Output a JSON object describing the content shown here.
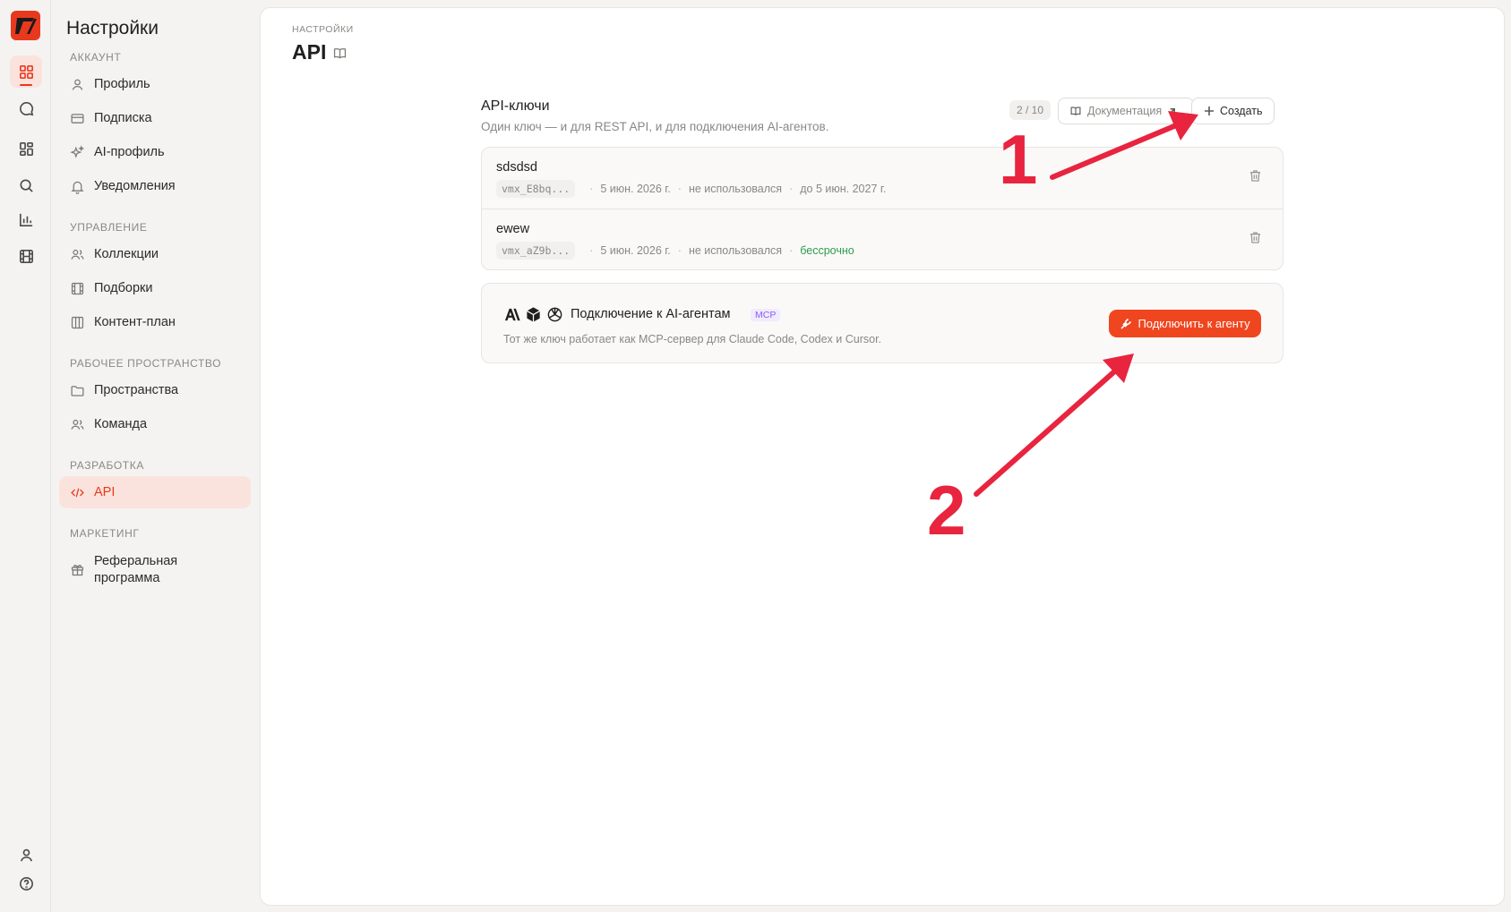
{
  "rail": {
    "items": [
      {
        "name": "dashboard",
        "active": true
      },
      {
        "name": "chat"
      },
      {
        "name": "widgets"
      },
      {
        "name": "search"
      },
      {
        "name": "analytics"
      },
      {
        "name": "film"
      }
    ],
    "bottom": [
      "user",
      "help"
    ]
  },
  "sidebar": {
    "title": "Настройки",
    "sections": {
      "account": "АККАУНТ",
      "management": "УПРАВЛЕНИЕ",
      "workspace": "РАБОЧЕЕ ПРОСТРАНСТВО",
      "development": "РАЗРАБОТКА",
      "marketing": "МАРКЕТИНГ"
    },
    "items": {
      "profile": "Профиль",
      "subscription": "Подписка",
      "ai_profile": "AI-профиль",
      "notifications": "Уведомления",
      "collections": "Коллекции",
      "selections": "Подборки",
      "content_plan": "Контент-план",
      "spaces": "Пространства",
      "team": "Команда",
      "api": "API",
      "referral_line1": "Реферальная",
      "referral_line2": "программа"
    }
  },
  "header": {
    "breadcrumb": "НАСТРОЙКИ",
    "title": "API"
  },
  "keys": {
    "title": "API-ключи",
    "subtitle": "Один ключ — и для REST API, и для подключения AI-агентов.",
    "count": "2 / 10",
    "docs_label": "Документация",
    "create_label": "Создать",
    "rows": [
      {
        "name": "sdsdsd",
        "token": "vmx_E8bq...",
        "created": "5 июн. 2026 г.",
        "usage": "не использовался",
        "expires": "до 5 июн. 2027 г."
      },
      {
        "name": "ewew",
        "token": "vmx_aZ9b...",
        "created": "5 июн. 2026 г.",
        "usage": "не использовался",
        "expires": "бессрочно"
      }
    ]
  },
  "agents": {
    "title": "Подключение к AI-агентам",
    "badge": "MCP",
    "subtitle": "Тот же ключ работает как MCP-сервер для Claude Code, Codex и Cursor.",
    "connect_label": "Подключить к агенту"
  },
  "annotations": {
    "one": "1",
    "two": "2"
  },
  "colors": {
    "accent": "#e8391e",
    "button": "#f0461f",
    "annotation": "#e8243f",
    "success": "#2e9b4f"
  }
}
